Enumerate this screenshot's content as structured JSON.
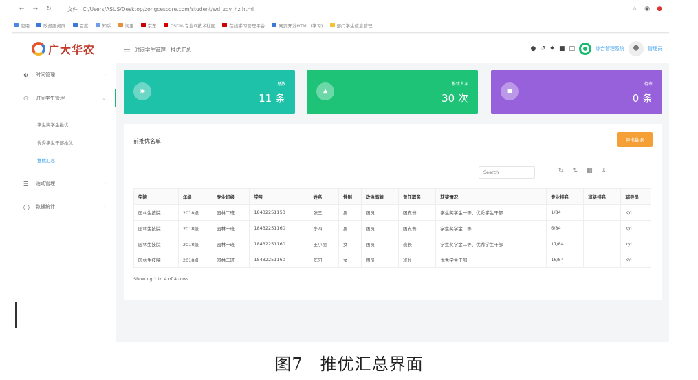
{
  "browser": {
    "nav_icons": [
      "back-icon",
      "forward-icon",
      "reload-icon"
    ],
    "url": "文件 | C:/Users/ASUS/Desktop/zongcescore.com/student/wd_zdy_hz.html",
    "bookmarks": [
      {
        "label": "应用",
        "color": "#4a86e8"
      },
      {
        "label": "政务服务网",
        "color": "#3c78d8"
      },
      {
        "label": "百度",
        "color": "#3c78d8"
      },
      {
        "label": "知乎",
        "color": "#6d9eeb"
      },
      {
        "label": "淘宝",
        "color": "#e69138"
      },
      {
        "label": "京东",
        "color": "#cc0000"
      },
      {
        "label": "CSDN-专业IT技术社区",
        "color": "#cc0000"
      },
      {
        "label": "在线学习管理平台",
        "color": "#cc0000"
      },
      {
        "label": "网页开发HTML (学习)",
        "color": "#3c78d8"
      },
      {
        "label": "部门学生信息管理",
        "color": "#f1c232"
      }
    ]
  },
  "app": {
    "logo_text": "广大华农",
    "breadcrumb": "时间学生管理 · 推优汇总",
    "header_user_link": "综合管理系统",
    "header_user_name": "管理员"
  },
  "sidebar": {
    "items": [
      {
        "label": "时间管理",
        "icon": "gear-icon"
      },
      {
        "label": "时间学生管理",
        "icon": "users-icon"
      },
      {
        "label": "活动管理",
        "icon": "list-icon"
      },
      {
        "label": "数据统计",
        "icon": "clock-icon"
      }
    ],
    "sub_items": [
      {
        "label": "学生奖学金推优"
      },
      {
        "label": "优秀学生干部推优"
      },
      {
        "label": "推优汇总"
      }
    ]
  },
  "cards": [
    {
      "label": "总数",
      "value": "11 条",
      "color": "#1ec2a8",
      "icon": "chat-icon"
    },
    {
      "label": "推优人次",
      "value": "30 次",
      "color": "#1ec378",
      "icon": "flame-icon"
    },
    {
      "label": "待审",
      "value": "0 条",
      "color": "#9761dc",
      "icon": "doc-icon"
    }
  ],
  "panel": {
    "title": "前推优名单",
    "export_label": "导出数据",
    "search_placeholder": "Search",
    "tool_icons": [
      "refresh-icon",
      "toggle-icon",
      "columns-icon",
      "export-icon"
    ],
    "columns": [
      "学院",
      "年级",
      "专业班级",
      "学号",
      "姓名",
      "性别",
      "政治面貌",
      "曾任职务",
      "获奖情况",
      "专业排名",
      "班级排名",
      "辅导员"
    ],
    "rows": [
      [
        "园林生技院",
        "2018级",
        "园林二班",
        "18432251153",
        "张三",
        "男",
        "团员",
        "团支书",
        "学生奖学金一等、优秀学生干部",
        "1/84",
        "",
        "kyi"
      ],
      [
        "园林生技院",
        "2018级",
        "园林一班",
        "18432251160",
        "李四",
        "男",
        "团员",
        "团支书",
        "学生奖学金二等",
        "6/84",
        "",
        "kyi"
      ],
      [
        "园林生技院",
        "2018级",
        "园林一班",
        "18432251160",
        "王小丽",
        "女",
        "团员",
        "班长",
        "学生奖学金二等、优秀学生干部",
        "17/84",
        "",
        "kyi"
      ],
      [
        "园林生技院",
        "2018级",
        "园林二班",
        "18432251160",
        "陈阳",
        "女",
        "团员",
        "班长",
        "优秀学生干部",
        "16/84",
        "",
        "kyi"
      ]
    ],
    "showing_text": "Showing 1 to 4 of 4 rows"
  },
  "caption": "图7　推优汇总界面"
}
